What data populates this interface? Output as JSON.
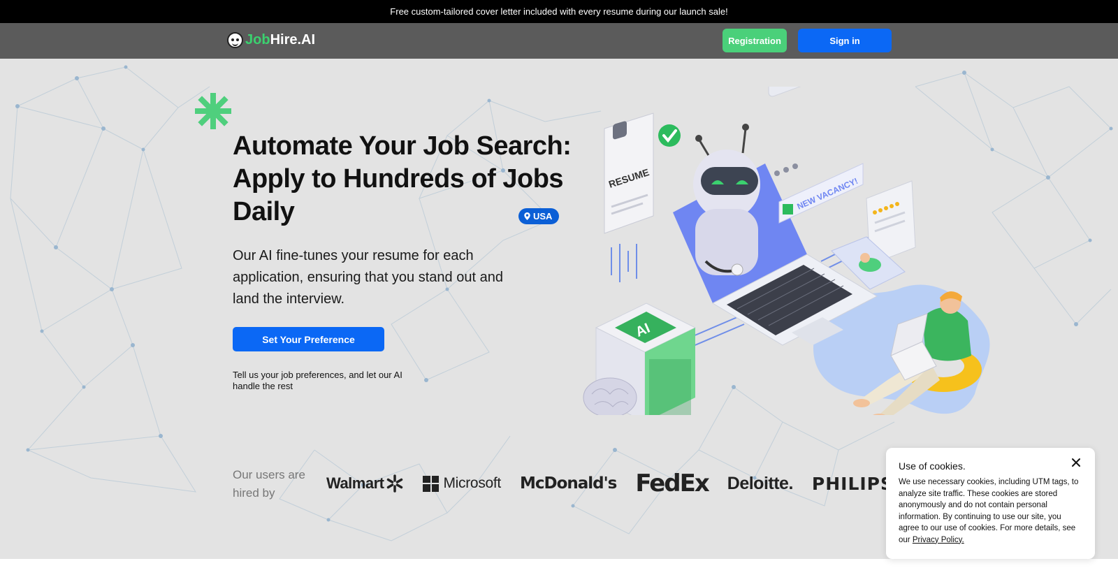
{
  "banner": {
    "text": "Free custom-tailored cover letter included with every resume during our launch sale!"
  },
  "header": {
    "logo_job": "Job",
    "logo_hire": "Hire.AI",
    "registration_label": "Registration",
    "signin_label": "Sign in"
  },
  "hero": {
    "headline": "Automate Your Job Search: Apply to Hundreds of Jobs Daily",
    "badge": "USA",
    "subtext": "Our AI fine-tunes your resume for each application, ensuring that you stand out and land the interview.",
    "cta_label": "Set Your Preference",
    "cta_note": "Tell us your job preferences, and let our AI handle the rest"
  },
  "illustration": {
    "resume_label": "RESUME",
    "vacancy_label": "NEW VACANCY!",
    "ai_label": "AI"
  },
  "hired": {
    "label": "Our users are hired by",
    "brands": [
      "Walmart",
      "Microsoft",
      "McDonald's",
      "FedEx",
      "Deloitte.",
      "PHILIPS"
    ]
  },
  "cookie": {
    "title": "Use of cookies.",
    "text": "We use necessary cookies, including UTM tags, to analyze site traffic. These cookies are stored anonymously and do not contain personal information. By continuing to use our site, you agree to our use of cookies. For more details, see our",
    "link": "Privacy Policy."
  },
  "colors": {
    "brand_green": "#3bd16f",
    "brand_blue": "#0b68f5",
    "header_bg": "#5b5b5b",
    "hero_bg": "#e3e3e3"
  }
}
